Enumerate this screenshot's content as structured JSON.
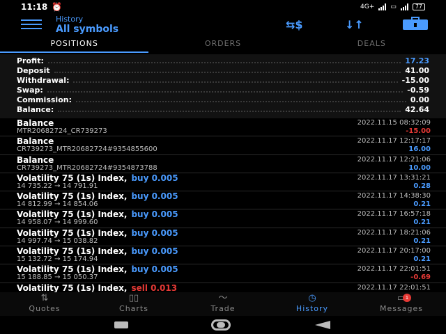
{
  "status": {
    "time": "11:18",
    "network": "4G+",
    "battery": "77"
  },
  "header": {
    "subtitle": "History",
    "title": "All symbols",
    "icons": [
      "currency-exchange-icon",
      "sort-icon",
      "briefcase-icon"
    ]
  },
  "tabs": [
    {
      "label": "POSITIONS",
      "active": true
    },
    {
      "label": "ORDERS",
      "active": false
    },
    {
      "label": "DEALS",
      "active": false
    }
  ],
  "summary": [
    {
      "label": "Profit:",
      "value": "17.23",
      "color": "#4a9bff"
    },
    {
      "label": "Deposit",
      "value": "41.00",
      "color": "#ffffff"
    },
    {
      "label": "Withdrawal:",
      "value": "-15.00",
      "color": "#ffffff"
    },
    {
      "label": "Swap:",
      "value": "-0.59",
      "color": "#ffffff"
    },
    {
      "label": "Commission:",
      "value": "0.00",
      "color": "#ffffff"
    },
    {
      "label": "Balance:",
      "value": "42.64",
      "color": "#ffffff"
    }
  ],
  "deals": [
    {
      "title": "Balance",
      "action": "",
      "action_color": "",
      "detail": "MTR20682724_CR739273",
      "date": "2022.11.15 08:32:09",
      "amount": "-15.00",
      "amount_color": "#e53935"
    },
    {
      "title": "Balance",
      "action": "",
      "action_color": "",
      "detail": "CR739273_MTR20682724#9354855600",
      "date": "2022.11.17 12:17:17",
      "amount": "16.00",
      "amount_color": "#4a9bff"
    },
    {
      "title": "Balance",
      "action": "",
      "action_color": "",
      "detail": "CR739273_MTR20682724#9354873788",
      "date": "2022.11.17 12:21:06",
      "amount": "10.00",
      "amount_color": "#4a9bff"
    },
    {
      "title": "Volatility 75 (1s) Index,",
      "action": "buy 0.005",
      "action_color": "#4a9bff",
      "detail": "14 735.22 → 14 791.91",
      "date": "2022.11.17 13:31:21",
      "amount": "0.28",
      "amount_color": "#4a9bff"
    },
    {
      "title": "Volatility 75 (1s) Index,",
      "action": "buy 0.005",
      "action_color": "#4a9bff",
      "detail": "14 812.99 → 14 854.06",
      "date": "2022.11.17 14:38:30",
      "amount": "0.21",
      "amount_color": "#4a9bff"
    },
    {
      "title": "Volatility 75 (1s) Index,",
      "action": "buy 0.005",
      "action_color": "#4a9bff",
      "detail": "14 958.07 → 14 999.60",
      "date": "2022.11.17 16:57:18",
      "amount": "0.21",
      "amount_color": "#4a9bff"
    },
    {
      "title": "Volatility 75 (1s) Index,",
      "action": "buy 0.005",
      "action_color": "#4a9bff",
      "detail": "14 997.74 → 15 038.82",
      "date": "2022.11.17 18:21:06",
      "amount": "0.21",
      "amount_color": "#4a9bff"
    },
    {
      "title": "Volatility 75 (1s) Index,",
      "action": "buy 0.005",
      "action_color": "#4a9bff",
      "detail": "15 132.72 → 15 174.94",
      "date": "2022.11.17 20:17:00",
      "amount": "0.21",
      "amount_color": "#4a9bff"
    },
    {
      "title": "Volatility 75 (1s) Index,",
      "action": "buy 0.005",
      "action_color": "#4a9bff",
      "detail": "15 188.85 → 15 050.37",
      "date": "2022.11.17 22:01:51",
      "amount": "-0.69",
      "amount_color": "#e53935"
    },
    {
      "title": "Volatility 75 (1s) Index,",
      "action": "sell 0.013",
      "action_color": "#e53935",
      "detail": "",
      "date": "2022.11.17 22:01:51",
      "amount": "",
      "amount_color": "#e53935"
    }
  ],
  "nav": [
    {
      "label": "Quotes",
      "icon": "quotes-icon",
      "active": false
    },
    {
      "label": "Charts",
      "icon": "charts-icon",
      "active": false
    },
    {
      "label": "Trade",
      "icon": "trade-icon",
      "active": false
    },
    {
      "label": "History",
      "icon": "history-icon",
      "active": true
    },
    {
      "label": "Messages",
      "icon": "messages-icon",
      "active": false,
      "badge": "1"
    }
  ]
}
